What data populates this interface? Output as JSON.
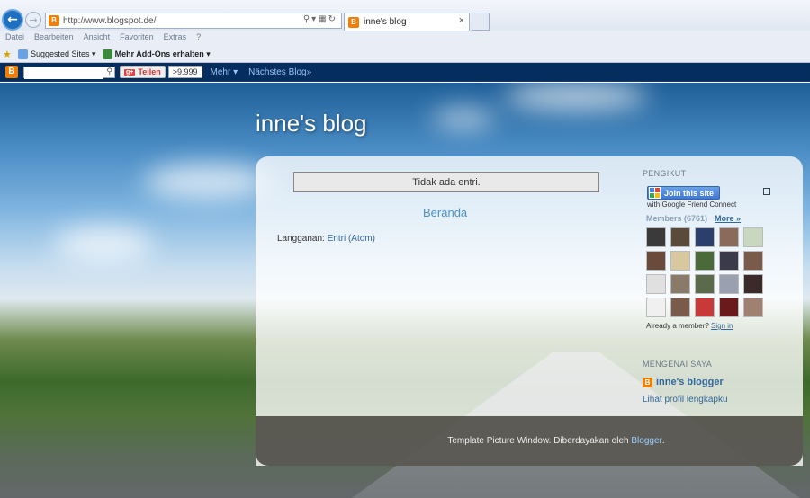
{
  "browser": {
    "url": "http://www.blogspot.de/",
    "tab_title": "inne's blog",
    "menu": [
      "Datei",
      "Bearbeiten",
      "Ansicht",
      "Favoriten",
      "Extras",
      "?"
    ],
    "favorites": [
      "Suggested Sites",
      "Mehr Add-Ons erhalten"
    ]
  },
  "blogger_bar": {
    "share_label": "Teilen",
    "share_count": ">9.999",
    "more_label": "Mehr",
    "next_blog": "Nächstes Blog»"
  },
  "blog": {
    "title": "inne's blog",
    "no_entries": "Tidak ada entri.",
    "home_link": "Beranda",
    "subscribe_label": "Langganan:",
    "subscribe_link": "Entri (Atom)"
  },
  "sidebar": {
    "followers_title": "PENGIKUT",
    "join_button": "Join this site",
    "gfc_text": "with Google Friend Connect",
    "members_label": "Members (6761)",
    "more_link": "More »",
    "already_member": "Already a member?",
    "sign_in": "Sign in",
    "about_title": "MENGENAI SAYA",
    "profile_name": "inne's blogger",
    "profile_link": "Lihat profil lengkapku"
  },
  "footer": {
    "text": "Template Picture Window. Diberdayakan oleh",
    "link": "Blogger",
    "suffix": "."
  },
  "avatar_colors": [
    "#3a3a3a",
    "#5a4a3a",
    "#2c3e6a",
    "#8a6a5a",
    "#c8d8c0",
    "#6a4a3a",
    "#d8c8a0",
    "#4a6a3a",
    "#3a3a4a",
    "#7a5a4a",
    "#e0e0e0",
    "#8a7a6a",
    "#5a6a4a",
    "#9aa0b0",
    "#3a2a2a",
    "#f0f0f0",
    "#7a5a4a",
    "#c83a3a",
    "#6a1a1a",
    "#a08070"
  ]
}
